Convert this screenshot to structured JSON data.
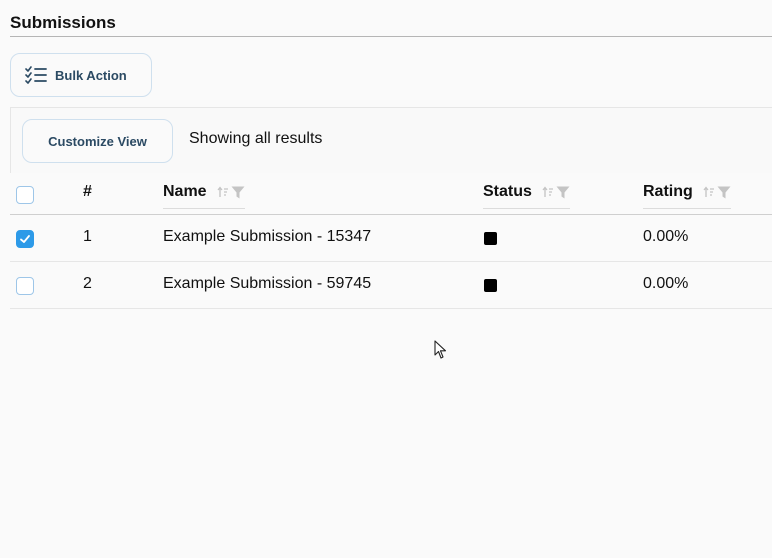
{
  "page": {
    "title": "Submissions"
  },
  "actions": {
    "bulk_label": "Bulk Action",
    "customize_label": "Customize View"
  },
  "toolbar": {
    "results_text": "Showing all results"
  },
  "table": {
    "columns": {
      "number": "#",
      "name": "Name",
      "status": "Status",
      "rating": "Rating"
    },
    "rows": [
      {
        "checked": true,
        "number": "1",
        "name": "Example Submission - 15347",
        "status_color": "#000000",
        "rating": "0.00%"
      },
      {
        "checked": false,
        "number": "2",
        "name": "Example Submission - 59745",
        "status_color": "#000000",
        "rating": "0.00%"
      }
    ]
  },
  "colors": {
    "accent": "#2d9ae8",
    "button_text": "#2b4a63",
    "button_border": "#cfe0ee"
  },
  "icons": [
    "checklist-icon",
    "sort-icon",
    "filter-icon",
    "checkmark-icon",
    "mouse-cursor-icon"
  ]
}
